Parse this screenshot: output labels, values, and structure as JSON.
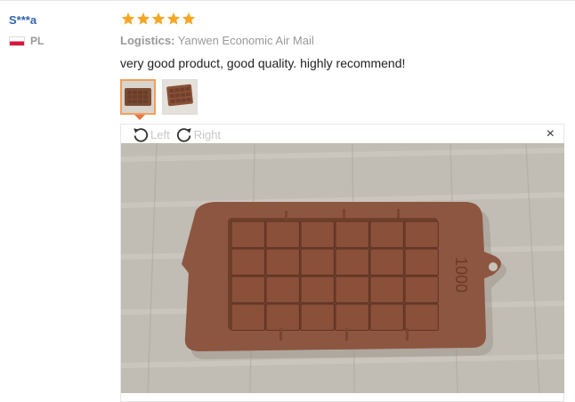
{
  "user": {
    "name": "S***a",
    "country": "PL",
    "flag_icon": "poland-flag-icon"
  },
  "rating": {
    "stars": 5,
    "max": 5,
    "color": "#f5a623"
  },
  "logistics": {
    "label": "Logistics:",
    "value": "Yanwen Economic Air Mail"
  },
  "review_text": "very good product, good quality. highly recommend!",
  "thumbnails": [
    {
      "selected": true
    },
    {
      "selected": false
    }
  ],
  "viewer": {
    "rotate_left_label": "Left",
    "rotate_right_label": "Right",
    "close_label": "×",
    "mold_text": "1000"
  }
}
